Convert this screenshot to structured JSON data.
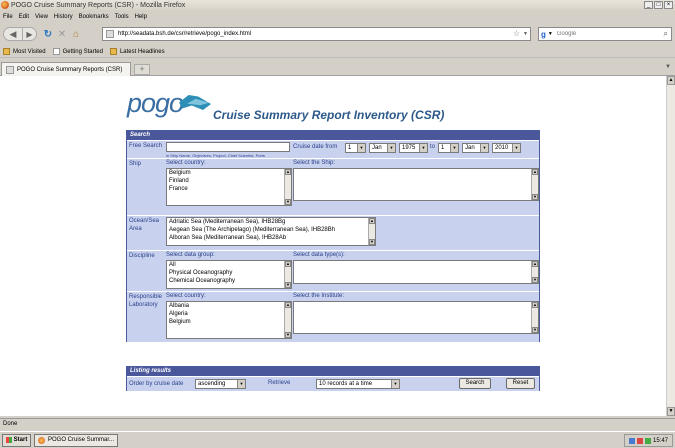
{
  "window": {
    "title": "POGO Cruise Summary Reports (CSR) - Mozilla Firefox",
    "min": "_",
    "max": "□",
    "close": "×"
  },
  "menu": [
    "File",
    "Edit",
    "View",
    "History",
    "Bookmarks",
    "Tools",
    "Help"
  ],
  "nav": {
    "url": "http://seadata.bsh.de/csr/retrieve/pogo_index.html",
    "search_placeholder": "Google"
  },
  "bookmarks": [
    "Most Visited",
    "Getting Started",
    "Latest Headlines"
  ],
  "tab": {
    "label": "POGO Cruise Summary Reports (CSR)",
    "new": "+"
  },
  "page": {
    "logo": "pogo",
    "heading": "Cruise Summary Report Inventory (CSR)",
    "search": {
      "header": "Search",
      "free_search": {
        "label": "Free Search",
        "value": "",
        "hint": "in Ship Name, Objectives, Project, Chief Scientist, Ports"
      },
      "cruise_date": {
        "label": "Cruise date from",
        "from_day": "1",
        "from_month": "Jan",
        "from_year": "1975",
        "to_label": "to",
        "to_day": "1",
        "to_month": "Jan",
        "to_year": "2010"
      },
      "ship": {
        "label": "Ship",
        "country_label": "Select country:",
        "countries": [
          "",
          "Belgium",
          "Finland",
          "France"
        ],
        "ship_label": "Select the Ship:"
      },
      "ocean": {
        "label": "Ocean/Sea Area",
        "areas": [
          "Adriatic Sea (Mediterranean Sea), IHB28Bg",
          "Aegean Sea (The Archipelago) (Mediterranean Sea), IHB28Bh",
          "Alboran Sea (Mediterranean Sea), IHB28Ab"
        ]
      },
      "discipline": {
        "label": "Discipline",
        "group_label": "Select data group:",
        "groups": [
          "All",
          "Physical Oceanography",
          "Chemical Oceanography"
        ],
        "type_label": "Select data type(s):"
      },
      "lab": {
        "label": "Responsible Laboratory",
        "country_label": "Select country:",
        "countries": [
          "",
          "Albania",
          "Algeria",
          "Belgium"
        ],
        "institute_label": "Select the Institute:"
      }
    },
    "listing": {
      "header": "Listing results",
      "order_label": "Order by cruise date",
      "order_value": "ascending",
      "retrieve_label": "Retrieve",
      "retrieve_value": "10 records at a time",
      "search_btn": "Search",
      "reset_btn": "Reset"
    }
  },
  "status": "Done",
  "taskbar": {
    "start": "Start",
    "item": "POGO Cruise Summar...",
    "time": "15:47"
  }
}
